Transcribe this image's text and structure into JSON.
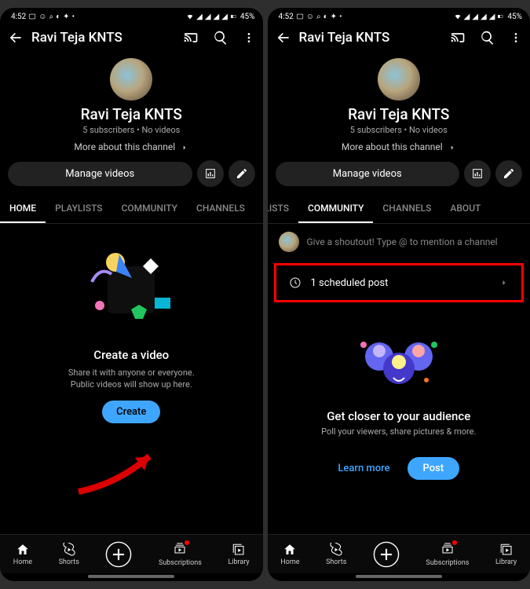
{
  "status": {
    "time": "4:52",
    "battery": "45%"
  },
  "header": {
    "title": "Ravi Teja KNTS"
  },
  "channel": {
    "name": "Ravi Teja KNTS",
    "subs": "5 subscribers",
    "dot": " • ",
    "videos": "No videos",
    "more": "More about this channel"
  },
  "buttons": {
    "manage": "Manage videos",
    "create": "Create",
    "post": "Post",
    "learn": "Learn more"
  },
  "tabs": {
    "home": "HOME",
    "playlists": "PLAYLISTS",
    "community": "COMMUNITY",
    "channels": "CHANNELS",
    "about": "ABOUT"
  },
  "emptyHome": {
    "title": "Create a video",
    "line1": "Share it with anyone or everyone.",
    "line2": "Public videos will show up here."
  },
  "shout": {
    "placeholder": "Give a shoutout! Type @ to mention a channel"
  },
  "scheduled": {
    "label": "1 scheduled post"
  },
  "audience": {
    "title": "Get closer to your audience",
    "desc": "Poll your viewers, share pictures & more."
  },
  "nav": {
    "home": "Home",
    "shorts": "Shorts",
    "subs": "Subscriptions",
    "library": "Library"
  }
}
